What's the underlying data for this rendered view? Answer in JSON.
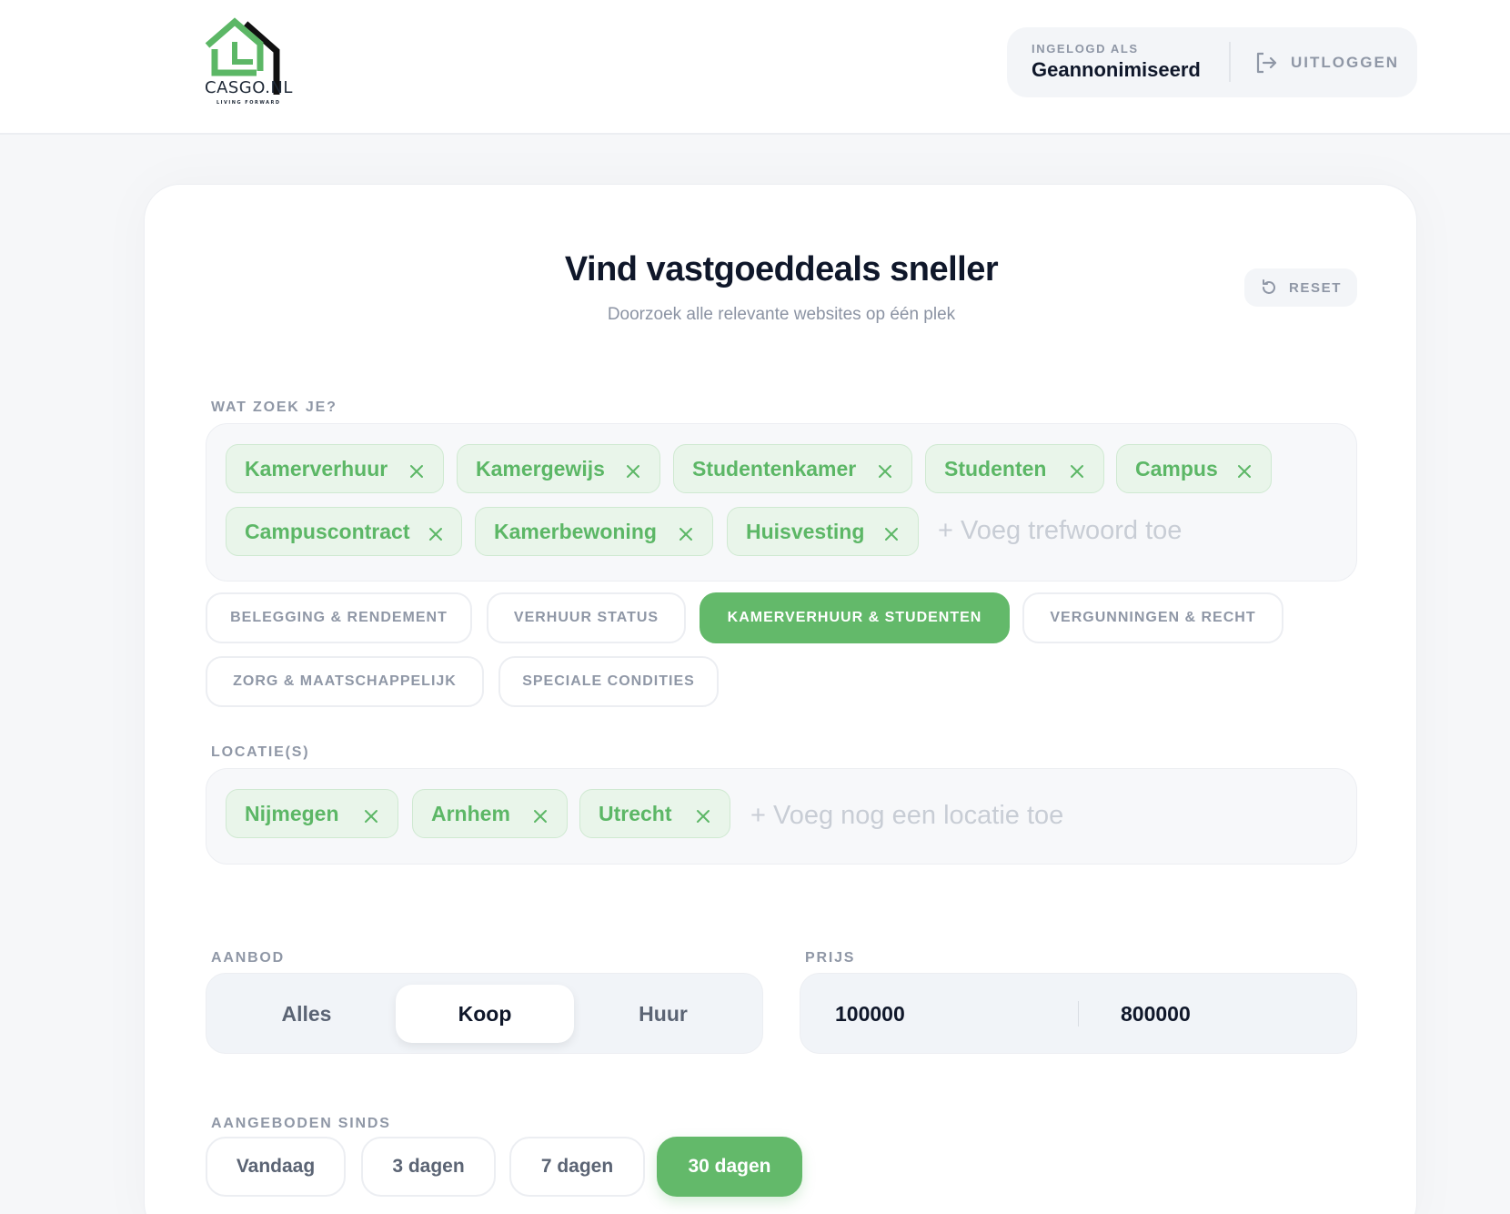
{
  "header": {
    "brand": "CASGO.NL",
    "tagline": "LIVING FORWARD",
    "logged_in_label": "INGELOGD ALS",
    "user_name": "Geannonimiseerd",
    "logout_label": "UITLOGGEN"
  },
  "hero": {
    "title": "Vind vastgoeddeals sneller",
    "subtitle": "Doorzoek alle relevante websites op één plek",
    "reset_label": "RESET"
  },
  "keywords": {
    "label": "WAT ZOEK JE?",
    "chips": [
      "Kamerverhuur",
      "Kamergewijs",
      "Studentenkamer",
      "Studenten",
      "Campus",
      "Campuscontract",
      "Kamerbewoning",
      "Huisvesting"
    ],
    "placeholder": "+ Voeg trefwoord toe"
  },
  "categories": {
    "items": [
      "BELEGGING & RENDEMENT",
      "VERHUUR STATUS",
      "KAMERVERHUUR & STUDENTEN",
      "VERGUNNINGEN & RECHT",
      "ZORG & MAATSCHAPPELIJK",
      "SPECIALE CONDITIES"
    ],
    "active": "KAMERVERHUUR & STUDENTEN"
  },
  "locations": {
    "label": "LOCATIE(S)",
    "chips": [
      "Nijmegen",
      "Arnhem",
      "Utrecht"
    ],
    "placeholder": "+ Voeg nog een locatie toe"
  },
  "offer": {
    "label": "AANBOD",
    "options": [
      "Alles",
      "Koop",
      "Huur"
    ],
    "selected": "Koop"
  },
  "price": {
    "label": "PRIJS",
    "min": "100000",
    "max": "800000"
  },
  "since": {
    "label": "AANGEBODEN SINDS",
    "options": [
      "Vandaag",
      "3 dagen",
      "7 dagen",
      "30 dagen"
    ],
    "selected": "30 dagen"
  },
  "colors": {
    "accent": "#63b96a",
    "chip_text": "#5cb766",
    "muted": "#8f97a6",
    "dark": "#0f172a"
  }
}
